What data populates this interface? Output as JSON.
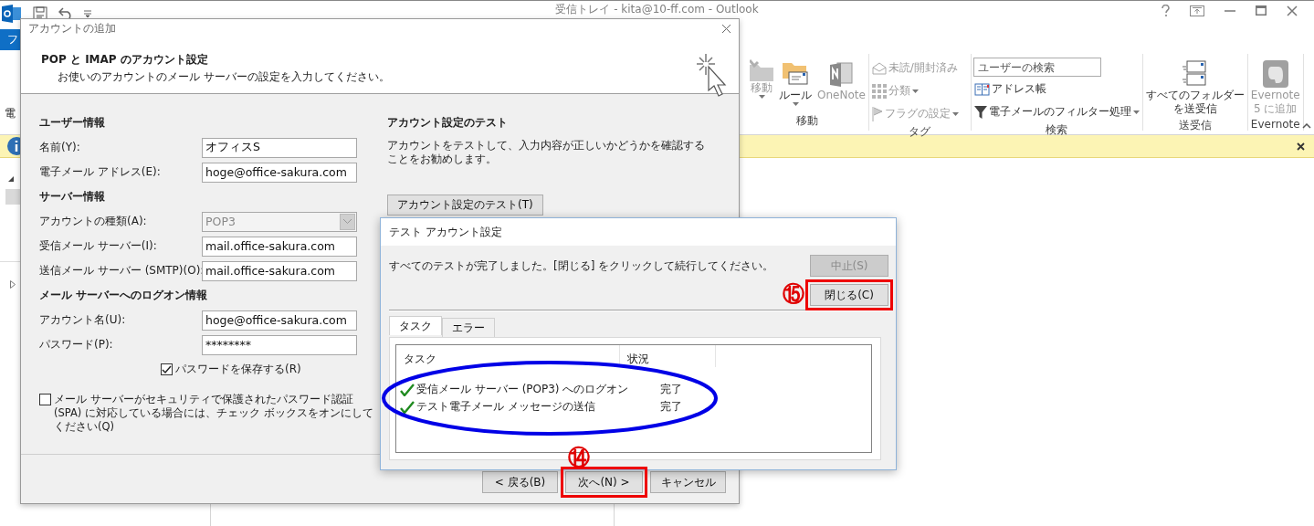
{
  "outlook": {
    "title": "受信トレイ - kita@10-ff.com - Outlook",
    "file_tab": "フ",
    "ribbon_cut_label": "電",
    "ribbon_groups": [
      {
        "label": "移動",
        "kind": "large",
        "items": [
          {
            "lines": [
              "移動"
            ],
            "disabled": true,
            "dropdown": true
          },
          {
            "lines": [
              "ルール"
            ],
            "disabled": false,
            "dropdown": true
          },
          {
            "lines": [
              "OneNote"
            ],
            "disabled": true,
            "dropdown": false
          }
        ]
      },
      {
        "label": "タグ",
        "kind": "small",
        "items": [
          {
            "label": "未読/開封済み",
            "disabled": true,
            "dropdown": false
          },
          {
            "label": "分類",
            "disabled": true,
            "dropdown": true
          },
          {
            "label": "フラグの設定",
            "disabled": true,
            "dropdown": true
          }
        ]
      },
      {
        "label": "検索",
        "kind": "search",
        "search_placeholder": "ユーザーの検索",
        "items": [
          {
            "label": "アドレス帳",
            "disabled": false,
            "dropdown": false
          },
          {
            "label": "電子メールのフィルター処理",
            "disabled": false,
            "dropdown": true
          }
        ]
      },
      {
        "label": "送受信",
        "kind": "large",
        "items": [
          {
            "lines": [
              "すべてのフォルダー",
              "を送受信"
            ],
            "disabled": false,
            "dropdown": false
          }
        ]
      },
      {
        "label": "Evernote",
        "kind": "large",
        "items": [
          {
            "lines": [
              "Evernote",
              "5 に追加"
            ],
            "disabled": true,
            "dropdown": false
          }
        ]
      }
    ]
  },
  "account_dialog": {
    "title": "アカウントの追加",
    "heading": "POP と IMAP のアカウント設定",
    "subtitle": "お使いのアカウントのメール サーバーの設定を入力してください。",
    "sections": [
      {
        "heading": "ユーザー情報",
        "fields": [
          {
            "label": "名前(Y):",
            "value": "オフィスS",
            "kind": "text",
            "disabled": false
          },
          {
            "label": "電子メール アドレス(E):",
            "value": "hoge@office-sakura.com",
            "kind": "text",
            "disabled": false
          }
        ]
      },
      {
        "heading": "サーバー情報",
        "fields": [
          {
            "label": "アカウントの種類(A):",
            "value": "POP3",
            "kind": "select",
            "disabled": true
          },
          {
            "label": "受信メール サーバー(I):",
            "value": "mail.office-sakura.com",
            "kind": "text",
            "disabled": false
          },
          {
            "label": "送信メール サーバー (SMTP)(O):",
            "value": "mail.office-sakura.com",
            "kind": "text",
            "disabled": false
          }
        ]
      },
      {
        "heading": "メール サーバーへのログオン情報",
        "fields": [
          {
            "label": "アカウント名(U):",
            "value": "hoge@office-sakura.com",
            "kind": "text",
            "disabled": false
          },
          {
            "label": "パスワード(P):",
            "value": "********",
            "kind": "text",
            "disabled": false
          }
        ]
      }
    ],
    "save_password": {
      "label": "パスワードを保存する(R)",
      "checked": true
    },
    "spa": {
      "label": "メール サーバーがセキュリティで保護されたパスワード認証 (SPA) に対応している場合には、チェック ボックスをオンにしてください(Q)",
      "checked": false
    },
    "test_section": {
      "heading": "アカウント設定のテスト",
      "description": "アカウントをテストして、入力内容が正しいかどうかを確認することをお勧めします。",
      "button": "アカウント設定のテスト(T)"
    },
    "buttons": [
      {
        "label": "< 戻る(B)",
        "highlighted": false
      },
      {
        "label": "次へ(N) >",
        "highlighted": true,
        "annotation": "⑭"
      },
      {
        "label": "キャンセル",
        "highlighted": false
      }
    ]
  },
  "test_dialog": {
    "title": "テスト アカウント設定",
    "message": "すべてのテストが完了しました。[閉じる] をクリックして続行してください。",
    "buttons": [
      {
        "label": "中止(S)",
        "disabled": true,
        "highlighted": false
      },
      {
        "label": "閉じる(C)",
        "disabled": false,
        "highlighted": true,
        "annotation": "⑮"
      }
    ],
    "tabs": [
      {
        "label": "タスク",
        "selected": true
      },
      {
        "label": "エラー",
        "selected": false
      }
    ],
    "columns": [
      "タスク",
      "状況"
    ],
    "rows": [
      {
        "task": "受信メール サーバー (POP3) へのログオン",
        "status": "完了",
        "done": true
      },
      {
        "task": "テスト電子メール メッセージの送信",
        "status": "完了",
        "done": true
      }
    ],
    "rows_circled": true
  }
}
